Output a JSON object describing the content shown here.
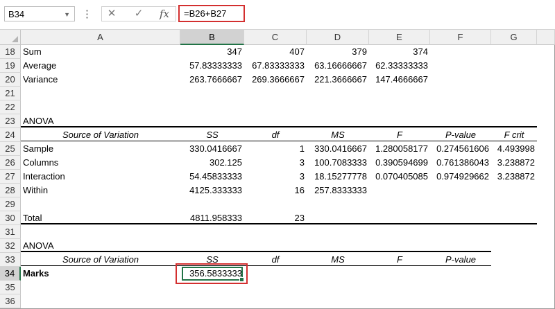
{
  "formula_bar": {
    "name_box": "B34",
    "cancel_icon": "✕",
    "enter_icon": "✓",
    "fx_label": "fx",
    "formula": "=B26+B27"
  },
  "columns": [
    "A",
    "B",
    "C",
    "D",
    "E",
    "F",
    "G"
  ],
  "selected_column": "B",
  "rows": [
    {
      "n": "18",
      "cells": {
        "A": "Sum",
        "B": "347",
        "C": "407",
        "D": "379",
        "E": "374"
      }
    },
    {
      "n": "19",
      "cells": {
        "A": "Average",
        "B": "57.83333333",
        "C": "67.83333333",
        "D": "63.16666667",
        "E": "62.33333333"
      }
    },
    {
      "n": "20",
      "cells": {
        "A": "Variance",
        "B": "263.7666667",
        "C": "269.3666667",
        "D": "221.3666667",
        "E": "147.4666667"
      }
    },
    {
      "n": "21",
      "cells": {}
    },
    {
      "n": "22",
      "cells": {}
    },
    {
      "n": "23",
      "cells": {
        "A": "ANOVA"
      }
    },
    {
      "n": "24",
      "cells": {
        "A": "Source of Variation",
        "B": "SS",
        "C": "df",
        "D": "MS",
        "E": "F",
        "F": "P-value",
        "G": "F crit"
      }
    },
    {
      "n": "25",
      "cells": {
        "A": "Sample",
        "B": "330.0416667",
        "C": "1",
        "D": "330.0416667",
        "E": "1.280058177",
        "F": "0.274561606",
        "G": "4.493998"
      }
    },
    {
      "n": "26",
      "cells": {
        "A": "Columns",
        "B": "302.125",
        "C": "3",
        "D": "100.7083333",
        "E": "0.390594699",
        "F": "0.761386043",
        "G": "3.238872"
      }
    },
    {
      "n": "27",
      "cells": {
        "A": "Interaction",
        "B": "54.45833333",
        "C": "3",
        "D": "18.15277778",
        "E": "0.070405085",
        "F": "0.974929662",
        "G": "3.238872"
      }
    },
    {
      "n": "28",
      "cells": {
        "A": "Within",
        "B": "4125.333333",
        "C": "16",
        "D": "257.8333333"
      }
    },
    {
      "n": "29",
      "cells": {}
    },
    {
      "n": "30",
      "cells": {
        "A": "Total",
        "B": "4811.958333",
        "C": "23"
      }
    },
    {
      "n": "31",
      "cells": {}
    },
    {
      "n": "32",
      "cells": {
        "A": "ANOVA"
      }
    },
    {
      "n": "33",
      "cells": {
        "A": "Source of Variation",
        "B": "SS",
        "C": "df",
        "D": "MS",
        "E": "F",
        "F": "P-value"
      }
    },
    {
      "n": "34",
      "cells": {
        "A": "Marks",
        "B": "356.5833333"
      }
    },
    {
      "n": "35",
      "cells": {}
    },
    {
      "n": "36",
      "cells": {}
    }
  ],
  "selected_row": "34",
  "colors": {
    "accent": "#217346",
    "highlight": "#d32f2f"
  }
}
